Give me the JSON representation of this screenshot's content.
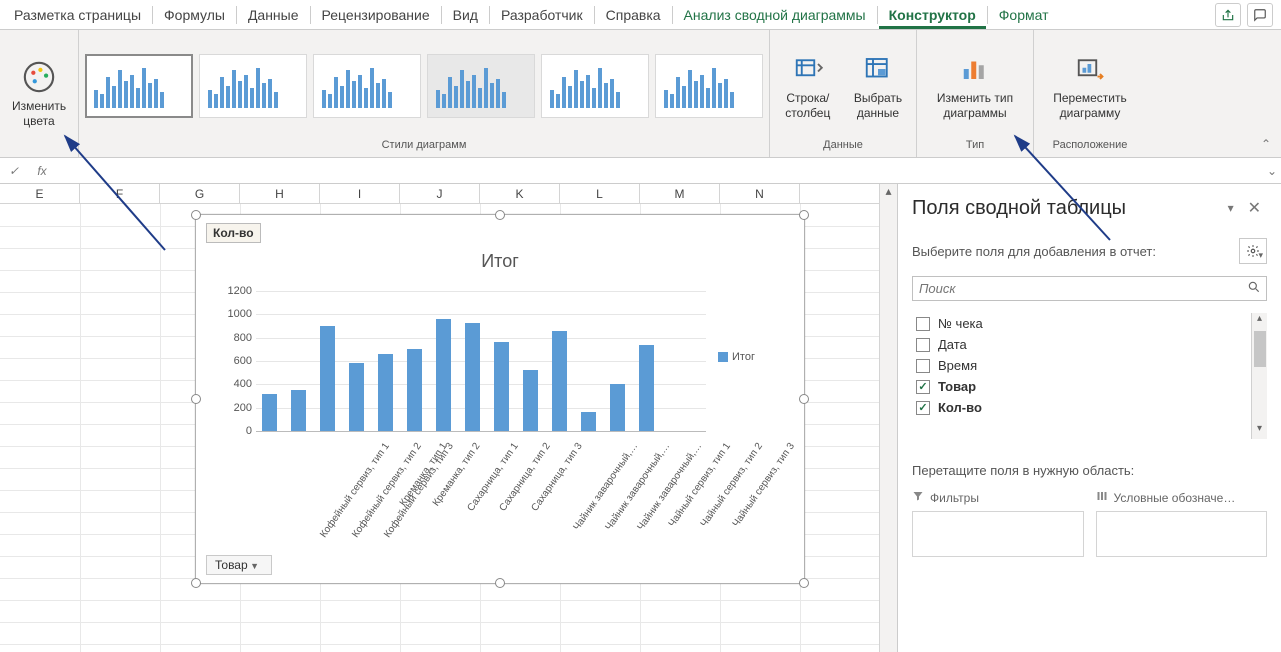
{
  "tabs": {
    "page_layout": "Разметка страницы",
    "formulas": "Формулы",
    "data": "Данные",
    "review": "Рецензирование",
    "view": "Вид",
    "developer": "Разработчик",
    "help": "Справка",
    "analyze": "Анализ сводной диаграммы",
    "design": "Конструктор",
    "format": "Формат"
  },
  "ribbon": {
    "change_colors": "Изменить\nцвета",
    "styles_label": "Стили диаграмм",
    "switch_rowcol": "Строка/\nстолбец",
    "select_data": "Выбрать\nданные",
    "data_label": "Данные",
    "change_type": "Изменить тип\nдиаграммы",
    "type_label": "Тип",
    "move_chart": "Переместить\nдиаграмму",
    "location_label": "Расположение"
  },
  "formula_bar": {
    "fx": "fx"
  },
  "columns": [
    "E",
    "F",
    "G",
    "H",
    "I",
    "J",
    "K",
    "L",
    "M",
    "N"
  ],
  "chart_box": {
    "badge": "Кол-во",
    "axis_button": "Товар"
  },
  "chart_data": {
    "type": "bar",
    "title": "Итог",
    "ylim": [
      0,
      1200
    ],
    "yticks": [
      0,
      200,
      400,
      600,
      800,
      1000,
      1200
    ],
    "legend": "Итог",
    "categories": [
      "Кофейный сервиз, тип 1",
      "Кофейный сервиз, тип 2",
      "Кофейный сервиз, тип 3",
      "Креманка, тип 1",
      "Креманка, тип 2",
      "Сахарница, тип 1",
      "Сахарница, тип 2",
      "Сахарница, тип 3",
      "Чайник заварочный,…",
      "Чайник заварочный,…",
      "Чайник заварочный,…",
      "Чайный сервиз, тип 1",
      "Чайный сервиз, тип 2",
      "Чайный сервиз, тип 3"
    ],
    "values": [
      320,
      350,
      900,
      580,
      660,
      700,
      960,
      930,
      760,
      520,
      860,
      160,
      400,
      740
    ]
  },
  "pane": {
    "title": "Поля сводной таблицы",
    "hint": "Выберите поля для добавления в отчет:",
    "search_placeholder": "Поиск",
    "fields": [
      {
        "label": "№ чека",
        "checked": false
      },
      {
        "label": "Дата",
        "checked": false
      },
      {
        "label": "Время",
        "checked": false
      },
      {
        "label": "Товар",
        "checked": true
      },
      {
        "label": "Кол-во",
        "checked": true
      }
    ],
    "drag_hint": "Перетащите поля в нужную область:",
    "filters_label": "Фильтры",
    "legend_label": "Условные обозначе…"
  }
}
